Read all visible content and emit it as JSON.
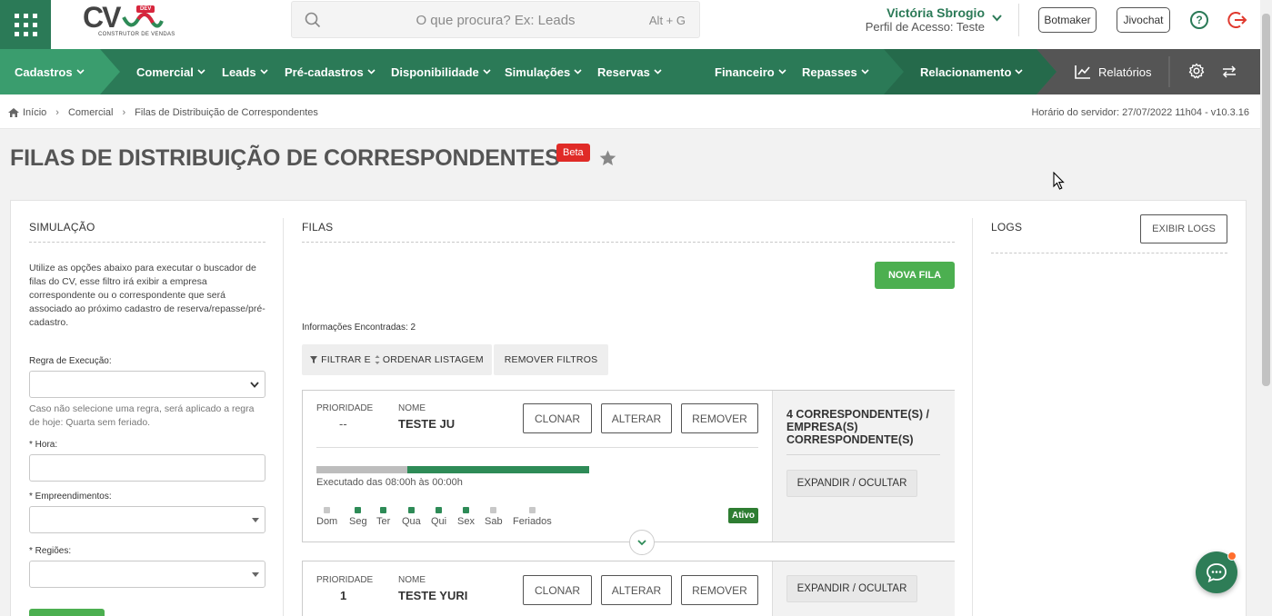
{
  "topbar": {
    "logo_text": "CV",
    "logo_badge": "DEV",
    "logo_subtitle": "CONSTRUTOR DE VENDAS",
    "search_placeholder": "O que procura? Ex: Leads",
    "search_shortcut": "Alt + G",
    "user_name": "Victória Sbrogio",
    "user_profile": "Perfil de Acesso: Teste",
    "botmaker_label": "Botmaker",
    "jivochat_label": "Jivochat",
    "help_label": "?"
  },
  "nav": {
    "cadastros": "Cadastros",
    "comercial": "Comercial",
    "leads": "Leads",
    "pre_cadastros": "Pré-cadastros",
    "disponibilidade": "Disponibilidade",
    "simulacoes": "Simulações",
    "reservas": "Reservas",
    "financeiro": "Financeiro",
    "repasses": "Repasses",
    "relacionamento": "Relacionamento",
    "relatorios": "Relatórios"
  },
  "breadcrumb": {
    "home": "Início",
    "comercial": "Comercial",
    "current": "Filas de Distribuição de Correspondentes",
    "server_time": "Horário do servidor: 27/07/2022 11h04 - v10.3.16"
  },
  "page": {
    "title": "FILAS DE DISTRIBUIÇÃO DE CORRESPONDENTES",
    "badge": "Beta"
  },
  "simulacao": {
    "title": "SIMULAÇÃO",
    "description": "Utilize as opções abaixo para executar o buscador de filas do CV, esse filtro irá exibir a empresa correspondente ou o correspondente que será associado ao próximo cadastro de reserva/repasse/pré-cadastro.",
    "regra_label": "Regra de Execução:",
    "regra_hint": "Caso não selecione uma regra, será aplicado a regra de hoje: Quarta sem feriado.",
    "hora_label": "* Hora:",
    "empreendimentos_label": "* Empreendimentos:",
    "regioes_label": "* Regiões:"
  },
  "filas": {
    "title": "FILAS",
    "new_button": "NOVA FILA",
    "found": "Informações Encontradas: 2",
    "filter_label": "FILTRAR E",
    "order_label": "ORDENAR LISTAGEM",
    "remove_filters": "REMOVER FILTROS",
    "priority_label": "PRIORIDADE",
    "name_label": "NOME",
    "clone_label": "CLONAR",
    "alter_label": "ALTERAR",
    "remove_label": "REMOVER",
    "expand_label": "EXPANDIR / OCULTAR",
    "items": [
      {
        "priority": "--",
        "name": "TESTE JU",
        "correspondents": "4 CORRESPONDENTE(S) / EMPRESA(S) CORRESPONDENTE(S)",
        "execution": "Executado das 08:00h às 00:00h",
        "status": "Ativo",
        "days": [
          {
            "label": "Dom",
            "active": false
          },
          {
            "label": "Seg",
            "active": true
          },
          {
            "label": "Ter",
            "active": true
          },
          {
            "label": "Qua",
            "active": true
          },
          {
            "label": "Qui",
            "active": true
          },
          {
            "label": "Sex",
            "active": true
          },
          {
            "label": "Sab",
            "active": false
          },
          {
            "label": "Feriados",
            "active": false
          }
        ]
      },
      {
        "priority": "1",
        "name": "TESTE YURI"
      }
    ]
  },
  "logs": {
    "title": "LOGS",
    "button": "EXIBIR LOGS"
  },
  "colors": {
    "brand_green": "#2b7a57",
    "button_green": "#4caf50",
    "beta_red": "#e02b27",
    "active_day": "#2e8b57",
    "inactive_day": "#c8c8c8"
  }
}
